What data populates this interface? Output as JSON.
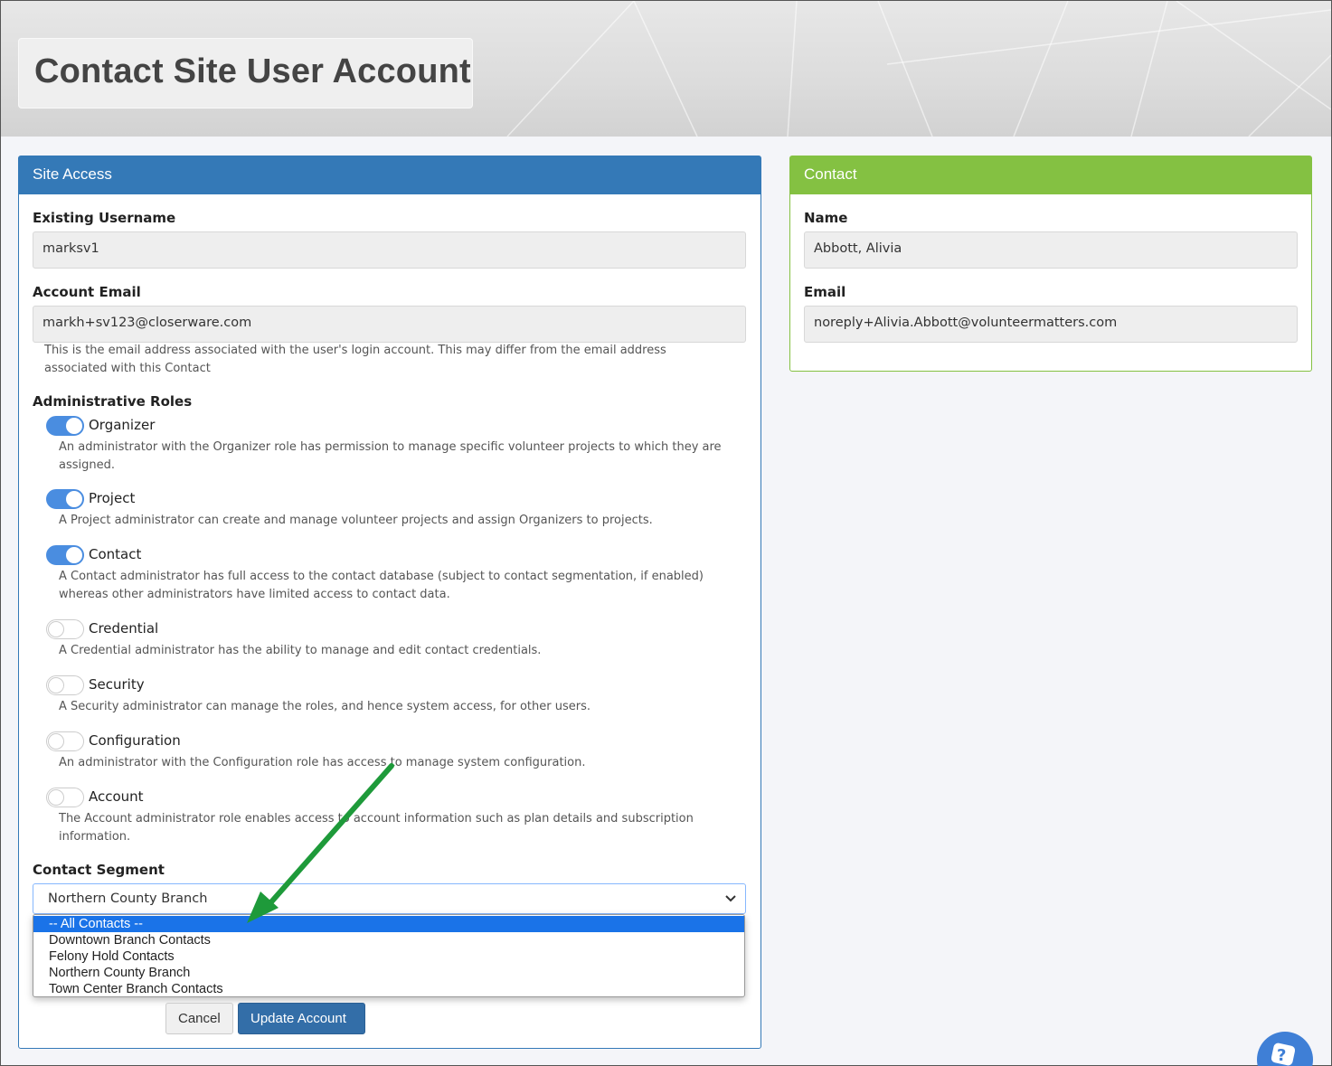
{
  "page": {
    "title": "Contact Site User Account"
  },
  "site_access": {
    "header": "Site Access",
    "existing_username_label": "Existing Username",
    "existing_username_value": "marksv1",
    "account_email_label": "Account Email",
    "account_email_value": "markh+sv123@closerware.com",
    "account_email_help_1": "This is the email address associated with the user's login account. This may differ from the email address",
    "account_email_help_2": "associated with this Contact",
    "roles_label": "Administrative Roles",
    "roles": [
      {
        "name": "Organizer",
        "on": true,
        "desc_1": "An administrator with the Organizer role has permission to manage specific volunteer projects to which they are",
        "desc_2": "assigned."
      },
      {
        "name": "Project",
        "on": true,
        "desc_1": "A Project administrator can create and manage volunteer projects and assign Organizers to projects.",
        "desc_2": ""
      },
      {
        "name": "Contact",
        "on": true,
        "desc_1": "A Contact administrator has full access to the contact database (subject to contact segmentation, if enabled)",
        "desc_2": "whereas other administrators have limited access to contact data."
      },
      {
        "name": "Credential",
        "on": false,
        "desc_1": "A Credential administrator has the ability to manage and edit contact credentials.",
        "desc_2": ""
      },
      {
        "name": "Security",
        "on": false,
        "desc_1": "A Security administrator can manage the roles, and hence system access, for other users.",
        "desc_2": ""
      },
      {
        "name": "Configuration",
        "on": false,
        "desc_1": "An administrator with the Configuration role has access to manage system configuration.",
        "desc_2": ""
      },
      {
        "name": "Account",
        "on": false,
        "desc_1": "The Account administrator role enables access to account information such as plan details and subscription",
        "desc_2": "information."
      }
    ],
    "segment_label": "Contact Segment",
    "segment_selected": "Northern County Branch",
    "segment_options": [
      "-- All Contacts --",
      "Downtown Branch Contacts",
      "Felony Hold Contacts",
      "Northern County Branch",
      "Town Center Branch Contacts"
    ],
    "segment_highlighted_index": 0,
    "cancel_label": "Cancel",
    "update_label": "Update Account"
  },
  "contact": {
    "header": "Contact",
    "name_label": "Name",
    "name_value": "Abbott, Alivia",
    "email_label": "Email",
    "email_value": "noreply+Alivia.Abbott@volunteermatters.com"
  },
  "colors": {
    "site_access_header": "#3479b7",
    "contact_header": "#84c142",
    "toggle_on": "#4a8de0",
    "update_button": "#336ea8",
    "annotation_arrow": "#1e9a3a"
  },
  "icons": {
    "help_fab": "help-question-icon",
    "select_chevron": "chevron-down-icon"
  }
}
